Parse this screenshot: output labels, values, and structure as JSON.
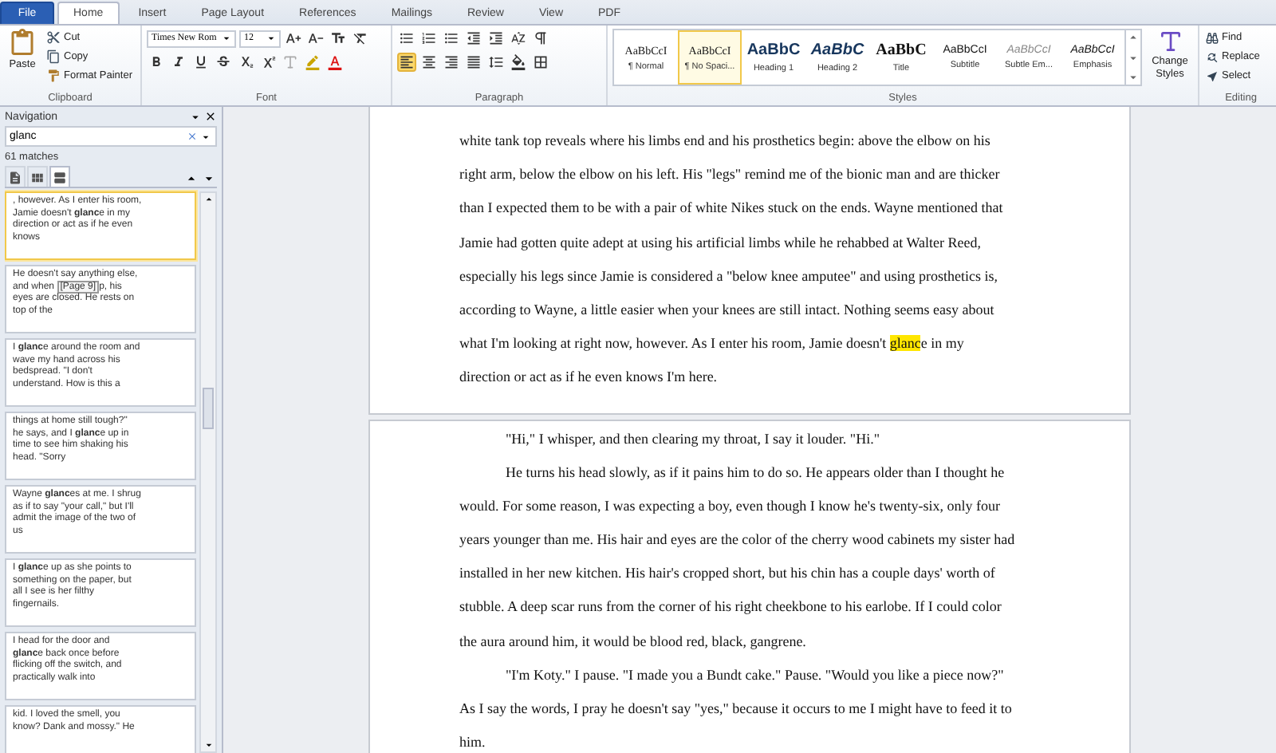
{
  "tabs": [
    {
      "label": "File",
      "kind": "file",
      "selected": false
    },
    {
      "label": "Home",
      "kind": "tab",
      "selected": true
    },
    {
      "label": "Insert",
      "kind": "tab",
      "selected": false
    },
    {
      "label": "Page Layout",
      "kind": "tab",
      "selected": false
    },
    {
      "label": "References",
      "kind": "tab",
      "selected": false
    },
    {
      "label": "Mailings",
      "kind": "tab",
      "selected": false
    },
    {
      "label": "Review",
      "kind": "tab",
      "selected": false
    },
    {
      "label": "View",
      "kind": "tab",
      "selected": false
    },
    {
      "label": "PDF",
      "kind": "tab",
      "selected": false
    }
  ],
  "clipboard": {
    "label": "Clipboard",
    "paste": "Paste",
    "cut": "Cut",
    "copy": "Copy",
    "format_painter": "Format Painter"
  },
  "font": {
    "label": "Font",
    "name": "Times New Rom",
    "size": "12"
  },
  "paragraph": {
    "label": "Paragraph",
    "alignment": [
      {
        "kind": "left",
        "selected": true
      },
      {
        "kind": "center",
        "selected": false
      },
      {
        "kind": "right",
        "selected": false
      },
      {
        "kind": "justify",
        "selected": false
      }
    ]
  },
  "styles": {
    "label": "Styles",
    "items": [
      {
        "sample": "AaBbCcI",
        "name": "¶ Normal",
        "kind": "normal",
        "selected": false
      },
      {
        "sample": "AaBbCcI",
        "name": "¶ No Spaci...",
        "kind": "normal",
        "selected": true
      },
      {
        "sample": "AaBbC",
        "name": "Heading 1",
        "kind": "heading1",
        "selected": false
      },
      {
        "sample": "AaBbC",
        "name": "Heading 2",
        "kind": "heading2",
        "selected": false
      },
      {
        "sample": "AaBbC",
        "name": "Title",
        "kind": "title",
        "selected": false
      },
      {
        "sample": "AaBbCcI",
        "name": "Subtitle",
        "kind": "subtitle",
        "selected": false
      },
      {
        "sample": "AaBbCcI",
        "name": "Subtle Em...",
        "kind": "subtle",
        "selected": false
      },
      {
        "sample": "AaBbCcI",
        "name": "Emphasis",
        "kind": "emphasis",
        "selected": false
      }
    ],
    "change_styles": [
      "Change",
      "Styles"
    ]
  },
  "editing": {
    "label": "Editing",
    "find": "Find",
    "replace": "Replace",
    "select": "Select"
  },
  "navigation": {
    "title": "Navigation",
    "search": "glanc",
    "matches": "61 matches",
    "views": [
      {
        "kind": "headings",
        "selected": false
      },
      {
        "kind": "pages",
        "selected": false
      },
      {
        "kind": "results",
        "selected": true
      }
    ],
    "results": [
      {
        "selected": true,
        "lines": [
          ", however. As I enter his room,",
          "Jamie doesn't **glanc**e in my",
          "direction or act as if he even",
          "knows"
        ]
      },
      {
        "selected": false,
        "tooltip": "[Page 9]",
        "lines": [
          "He doesn't say anything else,",
          [
            "and when",
            "p, his"
          ],
          "eyes are closed. He rests on",
          "top of the"
        ]
      },
      {
        "selected": false,
        "lines": [
          "I **glanc**e around the room and",
          "wave my hand across his",
          "bedspread. \"I don't",
          "understand. How is this a"
        ]
      },
      {
        "selected": false,
        "lines": [
          "things at home still tough?\"",
          "he says, and I **glanc**e up in",
          "time to see him shaking his",
          "head. \"Sorry"
        ]
      },
      {
        "selected": false,
        "lines": [
          "Wayne **glanc**es at me. I shrug",
          "as if to say \"your call,\" but I'll",
          "admit the image of the two of",
          "us"
        ]
      },
      {
        "selected": false,
        "lines": [
          "I **glanc**e up as she points to",
          "something on the paper, but",
          "all I see is her filthy",
          "fingernails."
        ]
      },
      {
        "selected": false,
        "lines": [
          "I head for the door and",
          "**glanc**e back once before",
          "flicking off the switch, and",
          "practically walk into"
        ]
      },
      {
        "selected": false,
        "lines": [
          "kid. I loved the smell, you",
          "know? Dank and mossy.\" He"
        ]
      }
    ]
  },
  "pages": [
    {
      "lines": [
        {
          "text": "white tank top reveals where his limbs end and his prosthetics begin: above the elbow on his",
          "indent": false
        },
        {
          "text": "right arm, below the elbow on his left. His \"legs\" remind me of the bionic man and are thicker",
          "indent": false
        },
        {
          "text": "than I expected them to be with a pair of white Nikes stuck on the ends. Wayne mentioned that",
          "indent": false
        },
        {
          "text": "Jamie had gotten quite adept at using his artificial limbs while he rehabbed at Walter Reed,",
          "indent": false
        },
        {
          "text": "especially his legs since Jamie is considered a \"below knee amputee\" and using prosthetics is,",
          "indent": false
        },
        {
          "text": "according to Wayne, a little easier when your knees are still intact. Nothing seems easy about",
          "indent": false
        },
        {
          "segments": [
            {
              "text": "what I'm looking at right now, however. As I enter his room, Jamie doesn't ",
              "highlighted": false
            },
            {
              "text": "glanc",
              "highlighted": true
            },
            {
              "text": "e in my",
              "highlighted": false
            }
          ],
          "indent": false
        },
        {
          "text": "direction or act as if he even knows I'm here.",
          "indent": false
        }
      ]
    },
    {
      "lines": [
        {
          "text": "\"Hi,\" I whisper, and then clearing my throat, I say it louder. \"Hi.\"",
          "indent": true
        },
        {
          "text": "He turns his head slowly, as if it pains him to do so. He appears older than I thought he",
          "indent": true
        },
        {
          "text": "would. For some reason, I was expecting a boy, even though I know he's twenty-six, only four",
          "indent": false
        },
        {
          "text": "years younger than me. His hair and eyes are the color of the cherry wood cabinets my sister had",
          "indent": false
        },
        {
          "text": "installed in her new kitchen. His hair's cropped short, but his chin has a couple days' worth of",
          "indent": false
        },
        {
          "text": "stubble. A deep scar runs from the corner of his right cheekbone to his earlobe. If I could color",
          "indent": false
        },
        {
          "text": "the aura around him, it would be blood red, black, gangrene.",
          "indent": false
        },
        {
          "text": "\"I'm Koty.\" I pause. \"I made you a Bundt cake.\" Pause. \"Would you like a piece now?\"",
          "indent": true
        },
        {
          "text": "As I say the words, I pray he doesn't say \"yes,\" because it occurs to me I might have to feed it to",
          "indent": false
        },
        {
          "text": "him.",
          "indent": false
        }
      ]
    }
  ]
}
